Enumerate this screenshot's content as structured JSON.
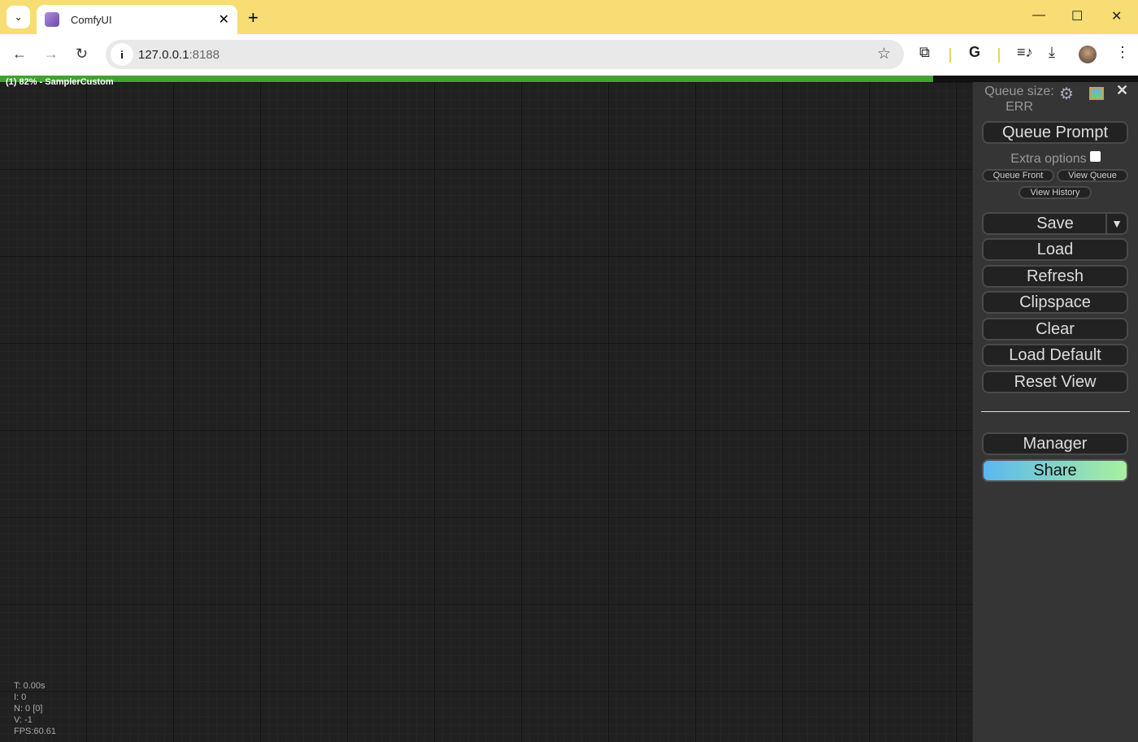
{
  "browser": {
    "tab_title": "ComfyUI",
    "url_host": "127.0.0.1",
    "url_port": ":8188",
    "icons": [
      "chevron-down-icon",
      "close-icon",
      "plus-icon",
      "minimize-icon",
      "maximize-icon",
      "back-icon",
      "forward-icon",
      "reload-icon",
      "info-icon",
      "star-icon",
      "extensions-icon",
      "google-icon",
      "media-icon",
      "download-icon",
      "avatar",
      "more-icon"
    ]
  },
  "progress": {
    "text": "(1) 82% - SamplerCustom",
    "percent": 82,
    "color": "#43a033"
  },
  "panel": {
    "queue_size_label": "Queue size:",
    "queue_size_value": "ERR",
    "queue_prompt": "Queue Prompt",
    "extra_options": "Extra options",
    "extra_options_checked": false,
    "queue_front": "Queue Front",
    "view_queue": "View Queue",
    "view_history": "View History",
    "save": "Save",
    "save_dropdown": "▼",
    "load": "Load",
    "refresh": "Refresh",
    "clipspace": "Clipspace",
    "clear": "Clear",
    "load_default": "Load Default",
    "reset_view": "Reset View",
    "manager": "Manager",
    "share": "Share"
  },
  "stats": {
    "t": "T: 0.00s",
    "i": "I: 0",
    "n": "N: 0 [0]",
    "v": "V: -1",
    "fps": "FPS:60.61"
  }
}
